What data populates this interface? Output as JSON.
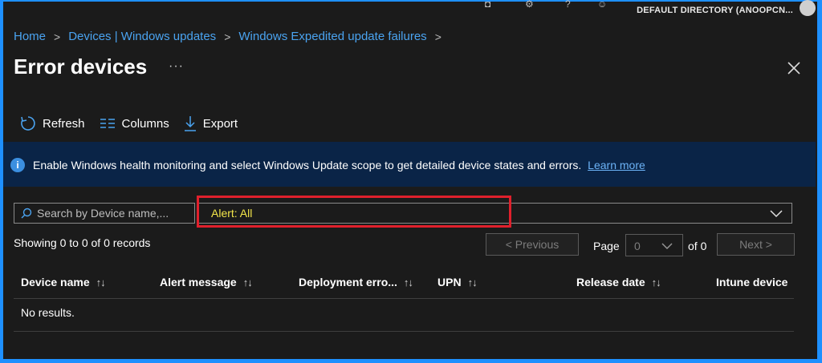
{
  "header": {
    "directory": "DEFAULT DIRECTORY (ANOOPCN..."
  },
  "breadcrumb": [
    "Home",
    "Devices | Windows updates",
    "Windows Expedited update failures"
  ],
  "page": {
    "title": "Error devices",
    "more": "···"
  },
  "toolbar": {
    "refresh": "Refresh",
    "columns": "Columns",
    "export": "Export"
  },
  "banner": {
    "message": "Enable Windows health monitoring and select Windows Update scope to get detailed device states and errors.",
    "link": "Learn more",
    "icon": "info-icon"
  },
  "search": {
    "placeholder": "Search by Device name,...",
    "value": ""
  },
  "filter": {
    "value": "Alert: All"
  },
  "pagination": {
    "records": "Showing 0 to 0 of 0 records",
    "previous": "< Previous",
    "page_label": "Page",
    "page_value": "0",
    "of_label": "of 0",
    "next": "Next >"
  },
  "table": {
    "columns": [
      "Device name",
      "Alert message",
      "Deployment erro...",
      "UPN",
      "Release date",
      "Intune device"
    ],
    "empty": "No results."
  },
  "colors": {
    "accent": "#1e90ff",
    "link": "#4aa3f0",
    "banner_bg": "#0a2447",
    "highlight": "#e0202c",
    "filter_text": "#f3e64a"
  }
}
